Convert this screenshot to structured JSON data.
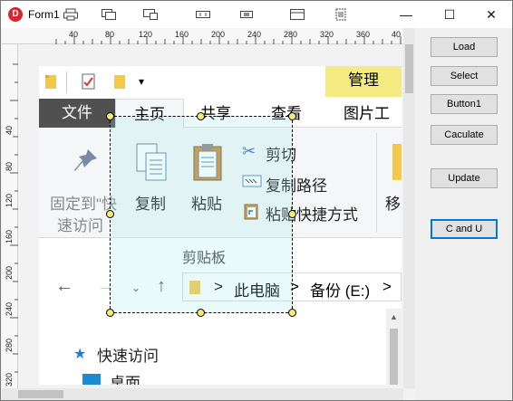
{
  "window": {
    "title": "Form1",
    "app_icon_letter": "D",
    "controls": {
      "minimize": "—",
      "maximize": "☐",
      "close": "✕"
    }
  },
  "ruler": {
    "top_labels": [
      "40",
      "80",
      "120",
      "160",
      "200",
      "240",
      "280",
      "320",
      "360",
      "40"
    ],
    "left_labels": [
      "40",
      "80",
      "120",
      "160",
      "200",
      "240",
      "280",
      "320"
    ]
  },
  "explorer": {
    "manage_tab": "管理",
    "tabs": {
      "file": "文件",
      "home": "主页",
      "share": "共享",
      "view": "查看",
      "picture_tools": "图片工具"
    },
    "ribbon": {
      "pin": "固定到\"快",
      "pin_line2": "速访问",
      "copy": "复制",
      "paste": "粘贴",
      "cut": "剪切",
      "copy_path": "复制路径",
      "paste_shortcut": "粘贴快捷方式",
      "move": "移",
      "group_clipboard": "剪贴板"
    },
    "address": {
      "this_pc": "此电脑",
      "drive": "备份 (E:)",
      "sep": ">"
    },
    "nav": {
      "quick_access": "快速访问",
      "desktop": "桌面"
    }
  },
  "side_buttons": [
    "Load",
    "Select",
    "Button1",
    "Caculate",
    "Update",
    "C and U"
  ],
  "colors": {
    "manage_tab": "#f4ec82",
    "file_tab": "#505050",
    "selection_fill": "#a0e6eb",
    "focus_border": "#0078d7",
    "app_icon": "#d9262c"
  }
}
